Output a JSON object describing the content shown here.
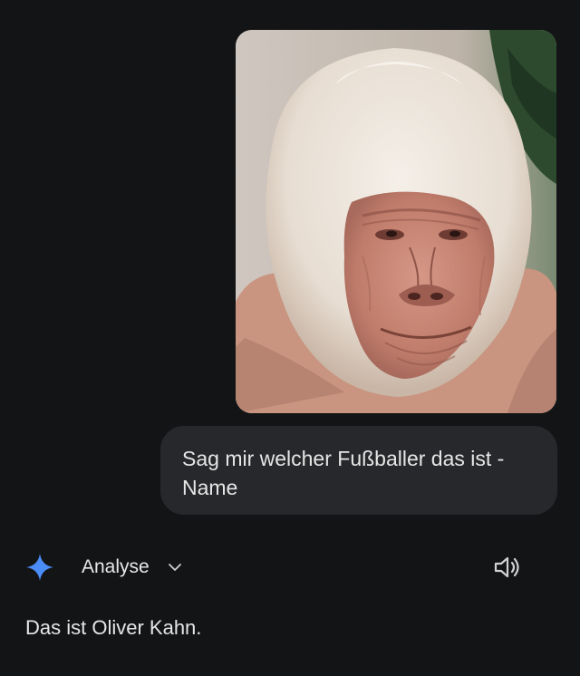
{
  "chat": {
    "user_message": "Sag mir welcher Fußballer das ist - Name",
    "response_mode_label": "Analyse",
    "answer": "Das ist Oliver Kahn."
  },
  "icons": {
    "assistant": "sparkle-icon",
    "expand": "chevron-down-icon",
    "read_aloud": "speaker-icon"
  },
  "colors": {
    "background": "#131416",
    "bubble": "#26282b",
    "sparkle": "#4b8df8",
    "text": "#e6e6e6"
  }
}
